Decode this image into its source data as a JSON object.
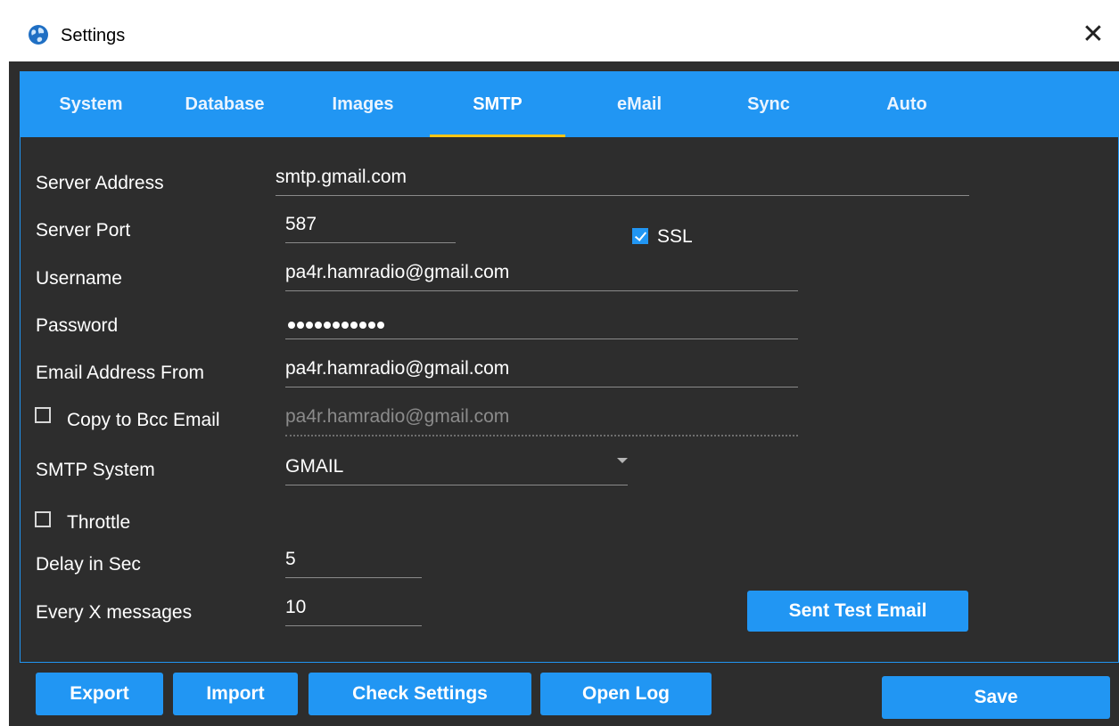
{
  "window": {
    "title": "Settings",
    "close_glyph": "✕"
  },
  "tabs": [
    {
      "label": "System"
    },
    {
      "label": "Database"
    },
    {
      "label": "Images"
    },
    {
      "label": "SMTP",
      "active": true
    },
    {
      "label": "eMail"
    },
    {
      "label": "Sync"
    },
    {
      "label": "Auto"
    }
  ],
  "form": {
    "server_address": {
      "label": "Server Address",
      "value": "smtp.gmail.com"
    },
    "server_port": {
      "label": "Server Port",
      "value": "587"
    },
    "ssl": {
      "label": "SSL",
      "checked": true
    },
    "username": {
      "label": "Username",
      "value": "pa4r.hamradio@gmail.com"
    },
    "password": {
      "label": "Password",
      "mask_length": 11
    },
    "email_from": {
      "label": "Email Address From",
      "value": "pa4r.hamradio@gmail.com"
    },
    "bcc": {
      "label": "Copy to Bcc Email",
      "checked": false,
      "value": "pa4r.hamradio@gmail.com"
    },
    "smtp_system": {
      "label": "SMTP System",
      "value": "GMAIL"
    },
    "throttle": {
      "label": "Throttle",
      "checked": false
    },
    "delay": {
      "label": "Delay in Sec",
      "value": "5"
    },
    "every_x": {
      "label": "Every X messages",
      "value": "10"
    },
    "test_button": "Sent Test Email"
  },
  "footer": {
    "export": "Export",
    "import": "Import",
    "check_settings": "Check Settings",
    "open_log": "Open Log",
    "save": "Save"
  },
  "colors": {
    "accent": "#2196f3",
    "tab_indicator": "#f5c518",
    "background": "#2d2d2d"
  }
}
